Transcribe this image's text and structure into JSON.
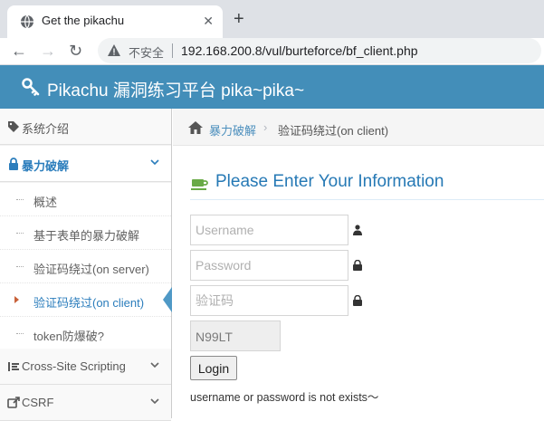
{
  "browser": {
    "tab_title": "Get the pikachu",
    "tab_close": "✕",
    "new_tab": "+",
    "insecure_label": "不安全",
    "url": "192.168.200.8/vul/burteforce/bf_client.php"
  },
  "header": {
    "brand": "Pikachu 漏洞练习平台 pika~pika~"
  },
  "sidebar": {
    "items": [
      {
        "label": "系统介绍",
        "icon": "tags-icon"
      },
      {
        "label": "暴力破解",
        "icon": "lock-icon",
        "expanded": true
      },
      {
        "label": "Cross-Site Scripting",
        "icon": "list-icon"
      },
      {
        "label": "CSRF",
        "icon": "share-icon"
      }
    ],
    "subitems": [
      {
        "label": "概述"
      },
      {
        "label": "基于表单的暴力破解"
      },
      {
        "label": "验证码绕过(on server)"
      },
      {
        "label": "验证码绕过(on client)",
        "active": true
      },
      {
        "label": "token防爆破?"
      }
    ]
  },
  "breadcrumb": {
    "link": "暴力破解",
    "separator": "›",
    "current": "验证码绕过(on client)"
  },
  "form": {
    "title": "Please Enter Your Information",
    "username_placeholder": "Username",
    "password_placeholder": "Password",
    "captcha_placeholder": "验证码",
    "captcha_code": "N99LT",
    "login_label": "Login",
    "message": "username or password is not exists～"
  },
  "colors": {
    "header_bg": "#438eb9",
    "accent": "#2679b5",
    "title": "#2679b5"
  }
}
